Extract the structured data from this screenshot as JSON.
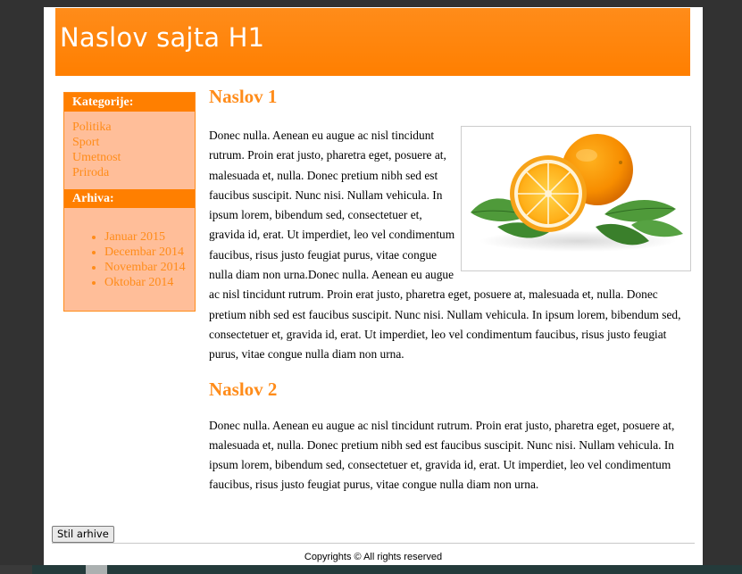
{
  "header": {
    "title": "Naslov sajta H1"
  },
  "sidebar": {
    "categories_heading": "Kategorije:",
    "categories": [
      "Politika",
      "Sport",
      "Umetnost",
      "Priroda"
    ],
    "archive_heading": "Arhiva:",
    "archive": [
      "Januar 2015",
      "Decembar 2014",
      "Novembar 2014",
      "Oktobar 2014"
    ]
  },
  "main": {
    "heading_1": "Naslov 1",
    "paragraph_1": "Donec nulla. Aenean eu augue ac nisl tincidunt rutrum. Proin erat justo, pharetra eget, posuere at, malesuada et, nulla. Donec pretium nibh sed est faucibus suscipit. Nunc nisi. Nullam vehicula. In ipsum lorem, bibendum sed, consectetuer et, gravida id, erat. Ut imperdiet, leo vel condimentum faucibus, risus justo feugiat purus, vitae congue nulla diam non urna.Donec nulla. Aenean eu augue ac nisl tincidunt rutrum. Proin erat justo, pharetra eget, posuere at, malesuada et, nulla. Donec pretium nibh sed est faucibus suscipit. Nunc nisi. Nullam vehicula. In ipsum lorem, bibendum sed, consectetuer et, gravida id, erat. Ut imperdiet, leo vel condimentum faucibus, risus justo feugiat purus, vitae congue nulla diam non urna.",
    "heading_2": "Naslov 2",
    "paragraph_2": "Donec nulla. Aenean eu augue ac nisl tincidunt rutrum. Proin erat justo, pharetra eget, posuere at, malesuada et, nulla. Donec pretium nibh sed est faucibus suscipit. Nunc nisi. Nullam vehicula. In ipsum lorem, bibendum sed, consectetuer et, gravida id, erat. Ut imperdiet, leo vel condimentum faucibus, risus justo feugiat purus, vitae congue nulla diam non urna."
  },
  "controls": {
    "archive_style_button": "Stil arhive"
  },
  "footer": {
    "copyright": "Copyrights © All rights reserved"
  },
  "colors": {
    "accent": "#ff7f00",
    "sidebar_bg": "#ffbe99",
    "link": "#ff8c1a",
    "page_bg": "#ffffff",
    "frame_bg": "#323232"
  },
  "images": {
    "fruit_icon": "orange-fruit-image"
  }
}
